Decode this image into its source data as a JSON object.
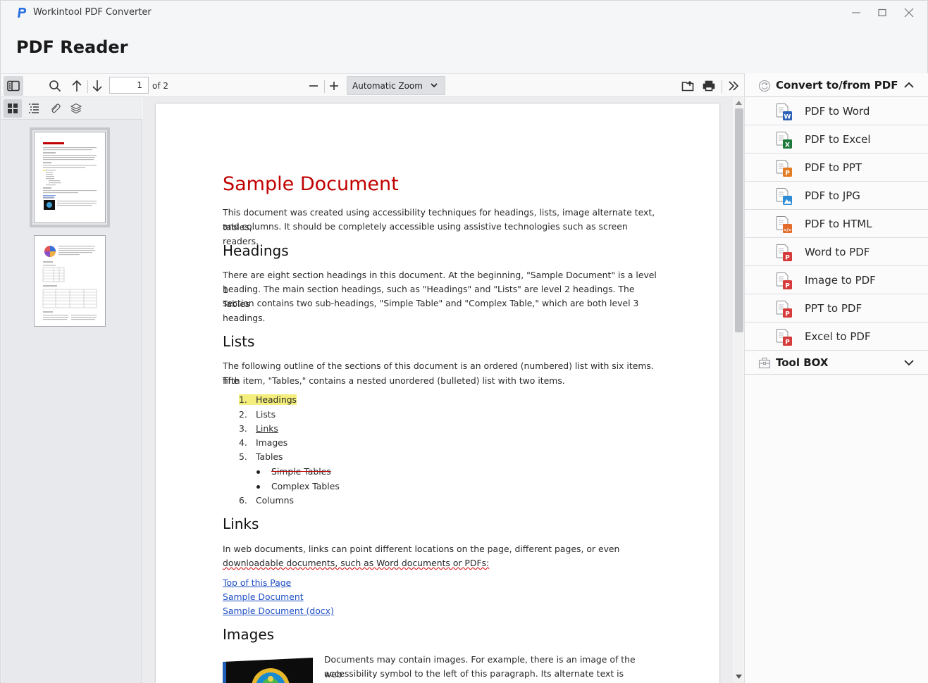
{
  "window": {
    "app_title": "Workintool PDF Converter",
    "page_heading": "PDF Reader"
  },
  "toolbar": {
    "page_number": "1",
    "page_count_label": "of 2",
    "zoom_label": "Automatic Zoom"
  },
  "document": {
    "title": "Sample Document",
    "intro_line1": "This document was created using accessibility techniques for headings, lists, image alternate text, tables,",
    "intro_line2": "and columns. It should be completely accessible using assistive technologies such as screen readers.",
    "headings_title": "Headings",
    "headings_line1": "There are eight section headings in this document. At the beginning, \"Sample Document\" is a level 1",
    "headings_line2": "heading. The main section headings, such as \"Headings\" and \"Lists\" are level 2 headings. The Tables",
    "headings_line3": "section contains two sub-headings, \"Simple Table\" and \"Complex Table,\" which are both level 3",
    "headings_line4": "headings.",
    "lists_title": "Lists",
    "lists_line1": "The following outline of the sections of this document is an ordered (numbered) list with six items. The",
    "lists_line2": "fifth item, \"Tables,\" contains a nested unordered (bulleted) list with two items.",
    "list_items": [
      {
        "num": "1.",
        "text": "Headings"
      },
      {
        "num": "2.",
        "text": "Lists"
      },
      {
        "num": "3.",
        "text": "Links"
      },
      {
        "num": "4.",
        "text": "Images"
      },
      {
        "num": "5.",
        "text": "Tables"
      },
      {
        "num": "6.",
        "text": "Columns"
      }
    ],
    "sub_items": [
      "Simple Tables",
      "Complex Tables"
    ],
    "links_title": "Links",
    "links_line1": "In web documents, links can point different locations on the page, different pages, or even",
    "links_line2": "downloadable documents, such as Word documents or PDFs:",
    "links": [
      "Top of this Page",
      "Sample Document",
      "Sample Document (docx)"
    ],
    "images_title": "Images",
    "images_line1": "Documents may contain images. For example, there is an image of the web",
    "images_line2": "accessibility symbol to the left of this paragraph. Its alternate text is \"Web"
  },
  "right_panel": {
    "convert_title": "Convert to/from PDF",
    "toolbox_title": "Tool BOX",
    "items": [
      {
        "label": "PDF to Word",
        "icon": "pdf-to-word-icon",
        "badge": "W",
        "color": "#2b5fb8"
      },
      {
        "label": "PDF to Excel",
        "icon": "pdf-to-excel-icon",
        "badge": "X",
        "color": "#1e7a3c"
      },
      {
        "label": "PDF to PPT",
        "icon": "pdf-to-ppt-icon",
        "badge": "P",
        "color": "#e37b22"
      },
      {
        "label": "PDF to JPG",
        "icon": "pdf-to-jpg-icon",
        "badge": "",
        "color": "#2e8bd6"
      },
      {
        "label": "PDF to HTML",
        "icon": "pdf-to-html-icon",
        "badge": "</>",
        "color": "#e36b2b"
      },
      {
        "label": "Word to PDF",
        "icon": "word-to-pdf-icon",
        "badge": "P",
        "color": "#d63a3a"
      },
      {
        "label": "Image to PDF",
        "icon": "image-to-pdf-icon",
        "badge": "P",
        "color": "#d63a3a"
      },
      {
        "label": "PPT to PDF",
        "icon": "ppt-to-pdf-icon",
        "badge": "P",
        "color": "#d63a3a"
      },
      {
        "label": "Excel to PDF",
        "icon": "excel-to-pdf-icon",
        "badge": "P",
        "color": "#d63a3a"
      }
    ]
  }
}
